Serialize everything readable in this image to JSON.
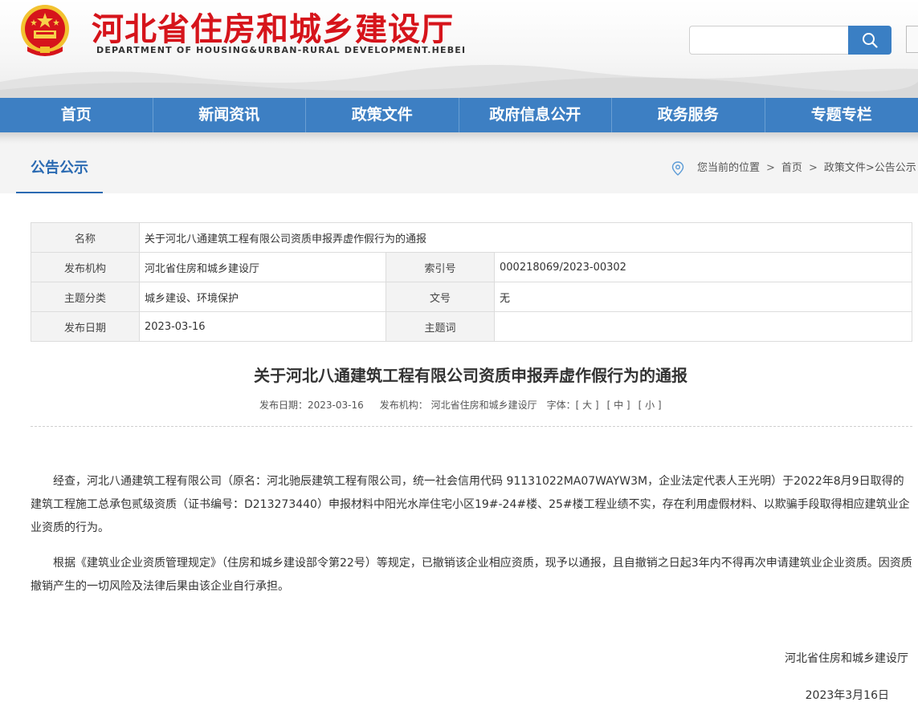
{
  "header": {
    "title": "河北省住房和城乡建设厅",
    "subtitle": "DEPARTMENT OF HOUSING&URBAN-RURAL DEVELOPMENT.HEBEI",
    "search_placeholder": ""
  },
  "nav": {
    "items": [
      "首页",
      "新闻资讯",
      "政策文件",
      "政府信息公开",
      "政务服务",
      "专题专栏"
    ]
  },
  "section": {
    "title": "公告公示",
    "location_label": "您当前的位置",
    "sep": ">",
    "crumb_home": "首页",
    "crumb_path": "政策文件>公告公示"
  },
  "info": {
    "name_label": "名称",
    "name_value": "关于河北八通建筑工程有限公司资质申报弄虚作假行为的通报",
    "org_label": "发布机构",
    "org_value": "河北省住房和城乡建设厅",
    "index_label": "索引号",
    "index_value": "000218069/2023-00302",
    "topic_label": "主题分类",
    "topic_value": "城乡建设、环境保护",
    "docno_label": "文号",
    "docno_value": "无",
    "date_label": "发布日期",
    "date_value": "2023-03-16",
    "keyword_label": "主题词",
    "keyword_value": ""
  },
  "article": {
    "title": "关于河北八通建筑工程有限公司资质申报弄虚作假行为的通报",
    "meta_date": "发布日期：2023-03-16",
    "meta_org": "发布机构： 河北省住房和城乡建设厅",
    "font_label": "字体：",
    "font_large": "[ 大 ]",
    "font_medium": "[ 中 ]",
    "font_small": "[ 小 ]",
    "paragraph1": "经查，河北八通建筑工程有限公司（原名：河北驰辰建筑工程有限公司，统一社会信用代码 91131022MA07WAYW3M，企业法定代表人王光明）于2022年8月9日取得的建筑工程施工总承包贰级资质（证书编号：D213273440）申报材料中阳光水岸住宅小区19#-24#楼、25#楼工程业绩不实，存在利用虚假材料、以欺骗手段取得相应建筑业企业资质的行为。",
    "paragraph2": "根据《建筑业企业资质管理规定》（住房和城乡建设部令第22号）等规定，已撤销该企业相应资质，现予以通报，且自撤销之日起3年内不得再次申请建筑业企业资质。因资质撤销产生的一切风险及法律后果由该企业自行承担。",
    "sign_org": "河北省住房和城乡建设厅",
    "sign_date": "2023年3月16日"
  },
  "colors": {
    "brand_red": "#d6141b",
    "nav_blue": "#3d7fc3",
    "accent_blue": "#2a6ab2"
  }
}
